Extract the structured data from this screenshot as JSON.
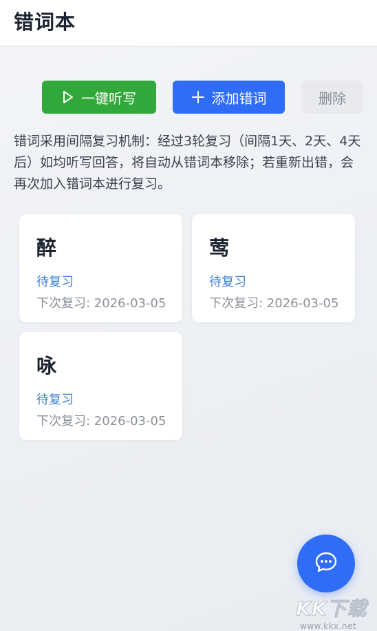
{
  "header": {
    "title": "错词本"
  },
  "toolbar": {
    "dictate_label": "一键听写",
    "add_label": "添加错词",
    "delete_label": "删除"
  },
  "description": "错词采用间隔复习机制：经过3轮复习（间隔1天、2天、4天后）如均听写回答，将自动从错词本移除；若重新出错，会再次加入错词本进行复习。",
  "words": [
    {
      "word": "醉",
      "status": "待复习",
      "next_review": "下次复习: 2026-03-05"
    },
    {
      "word": "莺",
      "status": "待复习",
      "next_review": "下次复习: 2026-03-05"
    },
    {
      "word": "咏",
      "status": "待复习",
      "next_review": "下次复习: 2026-03-05"
    }
  ],
  "watermark": {
    "logo": "KK下载",
    "url": "www.kkx.net"
  },
  "colors": {
    "dictate": "#31a93a",
    "primary": "#2f6df6",
    "status": "#3c7fd6"
  },
  "icons": {
    "dictate": "play-outline-icon",
    "add": "plus-icon",
    "fab": "chat-bubble-icon"
  }
}
